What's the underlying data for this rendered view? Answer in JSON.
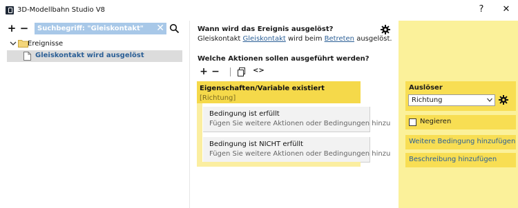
{
  "window": {
    "title": "3D-Modellbahn Studio V8",
    "help_label": "?",
    "close_label": "✕"
  },
  "left": {
    "add_label": "+",
    "remove_label": "−",
    "search_text": "Suchbegriff: \"Gleiskontakt\"",
    "search_clear_label": "✕",
    "tree": {
      "folder_label": "Ereignisse",
      "selected_label": "Gleiskontakt wird ausgelöst"
    }
  },
  "middle": {
    "question1": "Wann wird das Ereignis ausgelöst?",
    "sentence": {
      "part1": "Gleiskontakt ",
      "link1": "Gleiskontakt",
      "part2": " wird beim ",
      "link2": "Betreten",
      "part3": " ausgelöst."
    },
    "question2": "Welche Aktionen sollen ausgeführt werden?",
    "toolbar": {
      "add_label": "+",
      "remove_label": "−",
      "code_label": "<>"
    },
    "condition": {
      "title": "Eigenschaften/Variable existiert",
      "subtitle": "[Richtung]",
      "branches": [
        {
          "title": "Bedingung ist erfüllt",
          "hint": "Fügen Sie weitere Aktionen oder Bedingungen hinzu"
        },
        {
          "title": "Bedingung ist NICHT erfüllt",
          "hint": "Fügen Sie weitere Aktionen oder Bedingungen hinzu"
        }
      ]
    }
  },
  "right": {
    "trigger_title": "Auslöser",
    "trigger_value": "Richtung",
    "negate_label": "Negieren",
    "negate_checked": false,
    "add_condition_link": "Weitere Bedingung hinzufügen",
    "add_description_link": "Beschreibung hinzufügen"
  },
  "colors": {
    "accent_yellow": "#f5d94a",
    "panel_yellow": "#fbf19a",
    "link_blue": "#2b5f96",
    "search_bg": "#a8c8e8",
    "selection_gray": "#dcdcdc"
  }
}
